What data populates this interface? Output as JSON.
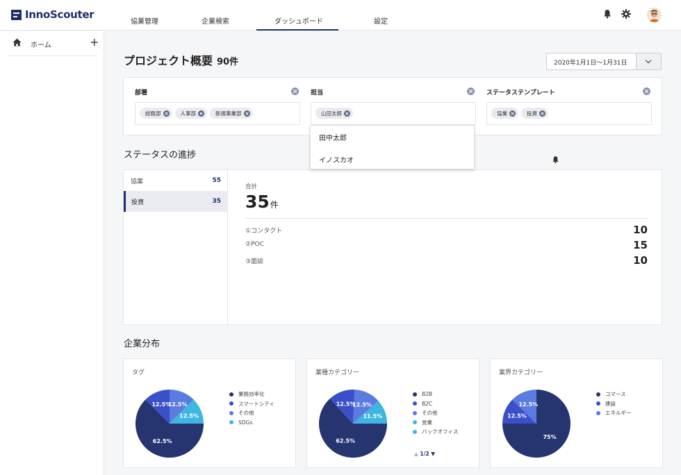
{
  "header": {
    "logo": "InnoScouter",
    "tabs": [
      {
        "label": "協業管理"
      },
      {
        "label": "企業検索"
      },
      {
        "label": "ダッシュボード"
      },
      {
        "label": "設定"
      }
    ],
    "active_tab": "ダッシュボード"
  },
  "sidebar": {
    "home_label": "ホーム",
    "add_symbol": "+"
  },
  "main": {
    "title": "プロジェクト概要",
    "title_count": "90件",
    "date_range": "2020年1月1日〜1月31日",
    "filters": [
      {
        "title": "部署",
        "chips": [
          "総務部",
          "人事部",
          "新規事業部"
        ]
      },
      {
        "title": "担当",
        "chips": [
          "山田太郎"
        ]
      },
      {
        "title": "ステータステンプレート",
        "chips": [
          "協業",
          "投資"
        ]
      }
    ],
    "dropdown_options": [
      "田中太郎",
      "イノスカオ"
    ],
    "status_section_title": "ステータスの進捗",
    "status_categories": [
      {
        "label": "協業",
        "count": "55"
      },
      {
        "label": "投資",
        "count": "35"
      }
    ],
    "active_category": "投資",
    "total_label": "合計",
    "total_value": "35",
    "total_unit": "件",
    "stages": [
      {
        "label": "①コンタクト",
        "value": "10"
      },
      {
        "label": "②POC",
        "value": "15"
      },
      {
        "label": "③面談",
        "value": "10"
      }
    ],
    "distribution_title": "企業分布",
    "pager": "1/2"
  },
  "colors": {
    "brand": "#1f2e6b",
    "slice_1": "#26346f",
    "slice_2": "#3a4fc9",
    "slice_3": "#5a7be0",
    "slice_4": "#3fb6e2"
  },
  "chart_data": [
    {
      "type": "pie",
      "title": "タグ",
      "categories": [
        "業務効率化",
        "スマートシティ",
        "その他",
        "SDGs"
      ],
      "values": [
        62.5,
        12.5,
        12.5,
        12.5
      ],
      "labels": [
        "62.5%",
        "12.5%",
        "12.5%",
        "12.5%"
      ],
      "legend": "right"
    },
    {
      "type": "pie",
      "title": "業種カテゴリー",
      "categories": [
        "B2B",
        "B2C",
        "その他",
        "営業",
        "バックオフィス"
      ],
      "values": [
        62.5,
        12.5,
        12.5,
        11.5
      ],
      "labels": [
        "62.5%",
        "12.5%",
        "12.5%",
        "11.5%"
      ],
      "legend": "right"
    },
    {
      "type": "pie",
      "title": "業界カテゴリー",
      "categories": [
        "コマース",
        "建設",
        "エネルギー"
      ],
      "values": [
        75,
        12.5,
        12.5
      ],
      "labels": [
        "75%",
        "12.5%",
        "12.5%"
      ],
      "legend": "right"
    }
  ]
}
